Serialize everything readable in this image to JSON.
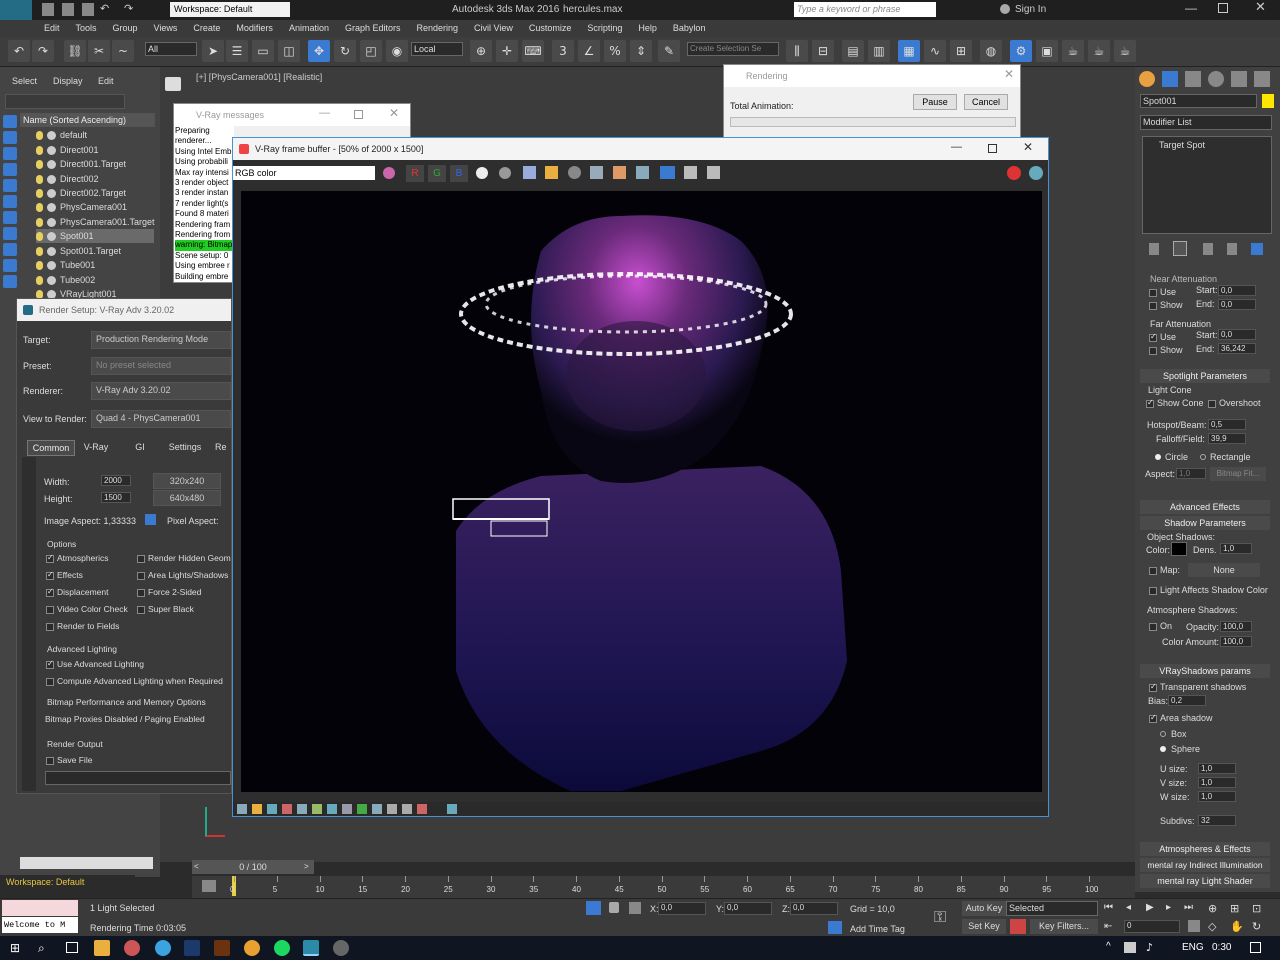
{
  "titlebar": {
    "workspace": "Workspace: Default",
    "title": "Autodesk 3ds Max 2016",
    "file": "hercules.max",
    "search_placeholder": "Type a keyword or phrase",
    "signin": "Sign In"
  },
  "menu": [
    "Edit",
    "Tools",
    "Group",
    "Views",
    "Create",
    "Modifiers",
    "Animation",
    "Graph Editors",
    "Rendering",
    "Civil View",
    "Customize",
    "Scripting",
    "Help",
    "Babylon"
  ],
  "toolbar": {
    "filter": "All",
    "coord": "Local",
    "selection_set_placeholder": "Create Selection Se"
  },
  "scene_explorer": {
    "tabs": [
      "Select",
      "Display",
      "Edit"
    ],
    "header": "Name (Sorted Ascending)",
    "items": [
      "default",
      "Direct001",
      "Direct001.Target",
      "Direct002",
      "Direct002.Target",
      "PhysCamera001",
      "PhysCamera001.Target",
      "Spot001",
      "Spot001.Target",
      "Tube001",
      "Tube002",
      "VRayLight001"
    ]
  },
  "viewport": {
    "label": "[+] [PhysCamera001] [Realistic]"
  },
  "vray_messages": {
    "title": "V-Ray messages",
    "lines": [
      "Preparing renderer...",
      "Using Intel Emb",
      "Using probabili",
      "Max ray intensi",
      "3 render object",
      "3 render instan",
      "7 render light(s",
      "Found 8 materi",
      "Rendering fram",
      "Rendering from",
      "warning: Bitmap",
      "Scene setup: 0",
      "Using embree r",
      "Building embre"
    ]
  },
  "rendering": {
    "title": "Rendering",
    "total": "Total Animation:",
    "pause": "Pause",
    "cancel": "Cancel"
  },
  "vfb": {
    "title": "V-Ray frame buffer - [50% of 2000 x 1500]",
    "channel": "RGB color",
    "r": "R",
    "g": "G",
    "b": "B"
  },
  "render_setup": {
    "title": "Render Setup: V-Ray Adv 3.20.02",
    "target_label": "Target:",
    "target": "Production Rendering Mode",
    "preset_label": "Preset:",
    "preset": "No preset selected",
    "renderer_label": "Renderer:",
    "renderer": "V-Ray Adv 3.20.02",
    "view_label": "View to Render:",
    "view": "Quad 4 - PhysCamera001",
    "tabs": [
      "Common",
      "V-Ray",
      "GI",
      "Settings",
      "Re"
    ],
    "width_label": "Width:",
    "width": "2000",
    "height_label": "Height:",
    "height": "1500",
    "preset_a": "320x240",
    "preset_b": "640x480",
    "aspect": "Image Aspect: 1,33333",
    "pixel_aspect": "Pixel Aspect:",
    "options_label": "Options",
    "options_left": [
      "Atmospherics",
      "Effects",
      "Displacement",
      "Video Color Check",
      "Render to Fields"
    ],
    "options_right": [
      "Render Hidden Geom",
      "Area Lights/Shadows",
      "Force 2-Sided",
      "Super Black"
    ],
    "adv_label": "Advanced Lighting",
    "adv1": "Use Advanced Lighting",
    "adv2": "Compute Advanced Lighting when Required",
    "bitmap_label": "Bitmap Performance and Memory Options",
    "bitmap": "Bitmap Proxies Disabled / Paging Enabled",
    "output_label": "Render Output",
    "save": "Save File"
  },
  "command_panel": {
    "object": "Spot001",
    "modifier_list": "Modifier List",
    "stack_item": "Target Spot",
    "near_att": "Near Attenuation",
    "far_att": "Far Attenuation",
    "use": "Use",
    "show": "Show",
    "start": "Start:",
    "end": "End:",
    "near_start": "0,0",
    "near_end": "0,0",
    "far_start": "0,0",
    "far_end": "36,242",
    "spot_params": "Spotlight Parameters",
    "light_cone": "Light Cone",
    "show_cone": "Show Cone",
    "overshoot": "Overshoot",
    "hotspot_label": "Hotspot/Beam:",
    "hotspot": "0,5",
    "falloff_label": "Falloff/Field:",
    "falloff": "39,9",
    "circle": "Circle",
    "rectangle": "Rectangle",
    "aspect_label": "Aspect:",
    "aspect": "1,0",
    "bitmap_fit": "Bitmap Fit...",
    "adv_effects": "Advanced Effects",
    "shadow_params": "Shadow Parameters",
    "obj_shadows": "Object Shadows:",
    "color_label": "Color:",
    "dens_label": "Dens.",
    "dens": "1,0",
    "map_label": "Map:",
    "map_value": "None",
    "light_affects": "Light Affects Shadow Color",
    "atm_shadows": "Atmosphere Shadows:",
    "on": "On",
    "opacity_label": "Opacity:",
    "opacity": "100,0",
    "color_amount_label": "Color Amount:",
    "color_amount": "100,0",
    "vray_shadows": "VRayShadows params",
    "transparent": "Transparent shadows",
    "bias_label": "Bias:",
    "bias": "0,2",
    "area_shadow": "Area shadow",
    "box": "Box",
    "sphere": "Sphere",
    "u_label": "U size:",
    "u": "1,0",
    "v_label": "V size:",
    "v": "1,0",
    "w_label": "W size:",
    "w": "1,0",
    "subdivs_label": "Subdivs:",
    "subdivs": "32",
    "atm_effects": "Atmospheres & Effects",
    "mr_indirect": "mental ray Indirect Illumination",
    "mr_shader": "mental ray Light Shader"
  },
  "timeline": {
    "frame": "0 / 100",
    "ticks": [
      "0",
      "5",
      "10",
      "15",
      "20",
      "25",
      "30",
      "35",
      "40",
      "45",
      "50",
      "55",
      "60",
      "65",
      "70",
      "75",
      "80",
      "85",
      "90",
      "95",
      "100"
    ]
  },
  "status": {
    "workspace": "Workspace: Default",
    "welcome": "Welcome to M",
    "selected": "1 Light Selected",
    "render_time": "Rendering Time  0:03:05",
    "x_label": "X:",
    "x": "0,0",
    "y_label": "Y:",
    "y": "0,0",
    "z_label": "Z:",
    "z": "0,0",
    "grid": "Grid = 10,0",
    "add_time_tag": "Add Time Tag",
    "auto_key": "Auto Key",
    "set_key": "Set Key",
    "selected_dd": "Selected",
    "key_filters": "Key Filters...",
    "frame_box": "0"
  },
  "taskbar": {
    "lang": "ENG",
    "time": "0:30"
  }
}
